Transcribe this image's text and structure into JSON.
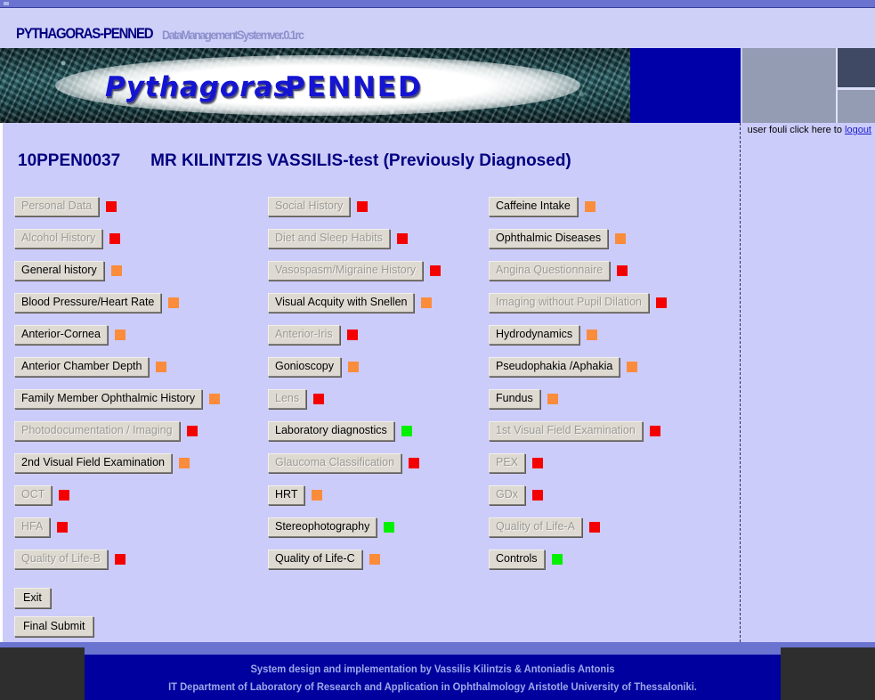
{
  "window": {
    "title_main": "PYTHAGORAS-PENNED",
    "title_sub": "DataManagementSystemver.0.1rc"
  },
  "banner": {
    "word1": "Pythagoras",
    "word2": "PENNED"
  },
  "userbar": {
    "text": "user fouli click here to ",
    "logout_label": "logout"
  },
  "patient": {
    "id": "10PPEN0037",
    "name": "MR KILINTZIS VASSILIS-test (Previously Diagnosed)"
  },
  "status_colors": {
    "red": "#f50000",
    "orange": "#fa8c3c",
    "green": "#00f000"
  },
  "modules": {
    "column1": [
      {
        "label": "Personal Data",
        "status": "red",
        "enabled": false
      },
      {
        "label": "Alcohol History",
        "status": "red",
        "enabled": false
      },
      {
        "label": "General history",
        "status": "orange",
        "enabled": true
      },
      {
        "label": "Blood Pressure/Heart Rate",
        "status": "orange",
        "enabled": true
      },
      {
        "label": "Anterior-Cornea",
        "status": "orange",
        "enabled": true
      },
      {
        "label": "Anterior Chamber Depth",
        "status": "orange",
        "enabled": true
      },
      {
        "label": "Family Member Ophthalmic History",
        "status": "orange",
        "enabled": true
      },
      {
        "label": "Photodocumentation / Imaging",
        "status": "red",
        "enabled": false
      },
      {
        "label": "2nd Visual Field Examination",
        "status": "orange",
        "enabled": true
      },
      {
        "label": "OCT",
        "status": "red",
        "enabled": false
      },
      {
        "label": "HFA",
        "status": "red",
        "enabled": false
      },
      {
        "label": "Quality of Life-B",
        "status": "red",
        "enabled": false
      }
    ],
    "column2": [
      {
        "label": "Social History",
        "status": "red",
        "enabled": false
      },
      {
        "label": "Diet and Sleep Habits",
        "status": "red",
        "enabled": false
      },
      {
        "label": "Vasospasm/Migraine History",
        "status": "red",
        "enabled": false
      },
      {
        "label": "Visual Acquity with Snellen",
        "status": "orange",
        "enabled": true
      },
      {
        "label": "Anterior-Iris",
        "status": "red",
        "enabled": false
      },
      {
        "label": "Gonioscopy",
        "status": "orange",
        "enabled": true
      },
      {
        "label": "Lens",
        "status": "red",
        "enabled": false
      },
      {
        "label": "Laboratory diagnostics",
        "status": "green",
        "enabled": true
      },
      {
        "label": "Glaucoma Classification",
        "status": "red",
        "enabled": false
      },
      {
        "label": "HRT",
        "status": "orange",
        "enabled": true
      },
      {
        "label": "Stereophotography",
        "status": "green",
        "enabled": true
      },
      {
        "label": "Quality of Life-C",
        "status": "orange",
        "enabled": true
      }
    ],
    "column3": [
      {
        "label": "Caffeine Intake",
        "status": "orange",
        "enabled": true
      },
      {
        "label": "Ophthalmic Diseases",
        "status": "orange",
        "enabled": true
      },
      {
        "label": "Angina Questionnaire",
        "status": "red",
        "enabled": false
      },
      {
        "label": "Imaging without Pupil Dilation",
        "status": "red",
        "enabled": false
      },
      {
        "label": "Hydrodynamics",
        "status": "orange",
        "enabled": true
      },
      {
        "label": "Pseudophakia /Aphakia",
        "status": "orange",
        "enabled": true
      },
      {
        "label": "Fundus",
        "status": "orange",
        "enabled": true
      },
      {
        "label": "1st Visual Field Examination",
        "status": "red",
        "enabled": false
      },
      {
        "label": "PEX",
        "status": "red",
        "enabled": false
      },
      {
        "label": "GDx",
        "status": "red",
        "enabled": false
      },
      {
        "label": "Quality of Life-A",
        "status": "red",
        "enabled": false
      },
      {
        "label": "Controls",
        "status": "green",
        "enabled": true
      }
    ]
  },
  "actions": {
    "exit_label": "Exit",
    "final_submit_label": "Final Submit"
  },
  "footer": {
    "line1": "System design and implementation by Vassilis Kilintzis & Antoniadis Antonis",
    "line2": "IT Department of Laboratory of Research and Application in Ophthalmology Aristotle University of Thessaloniki."
  }
}
